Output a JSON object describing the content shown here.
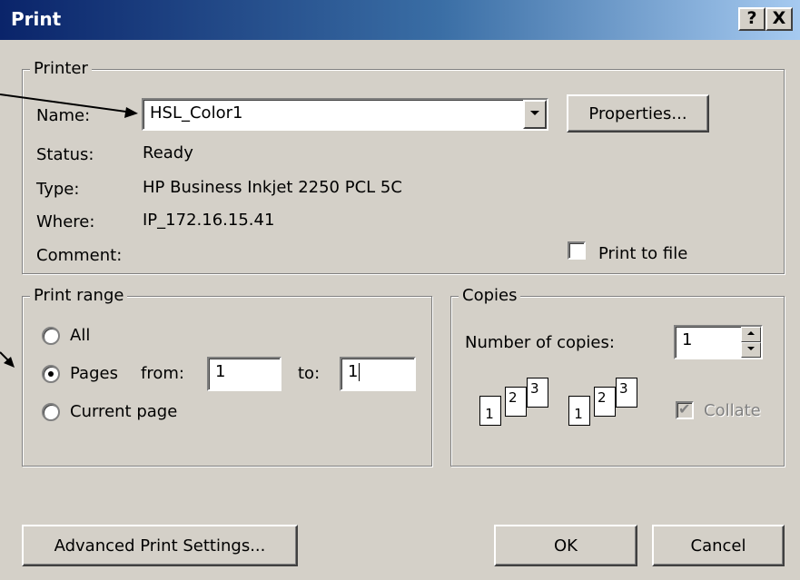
{
  "window": {
    "title": "Print",
    "help_button": "?",
    "close_button": "X"
  },
  "printer": {
    "group_title": "Printer",
    "name_label": "Name:",
    "name_value": "HSL_Color1",
    "properties_button": "Properties...",
    "status_label": "Status:",
    "status_value": "Ready",
    "type_label": "Type:",
    "type_value": "HP Business Inkjet 2250 PCL 5C",
    "where_label": "Where:",
    "where_value": "IP_172.16.15.41",
    "comment_label": "Comment:",
    "print_to_file_label": "Print to file",
    "print_to_file_checked": false
  },
  "print_range": {
    "group_title": "Print range",
    "all_label": "All",
    "pages_label": "Pages",
    "from_label": "from:",
    "from_value": "1",
    "to_label": "to:",
    "to_value": "1",
    "current_page_label": "Current page",
    "selected": "pages"
  },
  "copies": {
    "group_title": "Copies",
    "number_label": "Number of copies:",
    "number_value": "1",
    "collate_label": "Collate",
    "collate_checked": true,
    "collate_enabled": false,
    "page_numbers": [
      "1",
      "2",
      "3"
    ]
  },
  "buttons": {
    "advanced": "Advanced Print Settings...",
    "ok": "OK",
    "cancel": "Cancel"
  },
  "colors": {
    "dialog_bg": "#d4d0c8",
    "title_start": "#0a246a",
    "title_end": "#a6caf0"
  }
}
